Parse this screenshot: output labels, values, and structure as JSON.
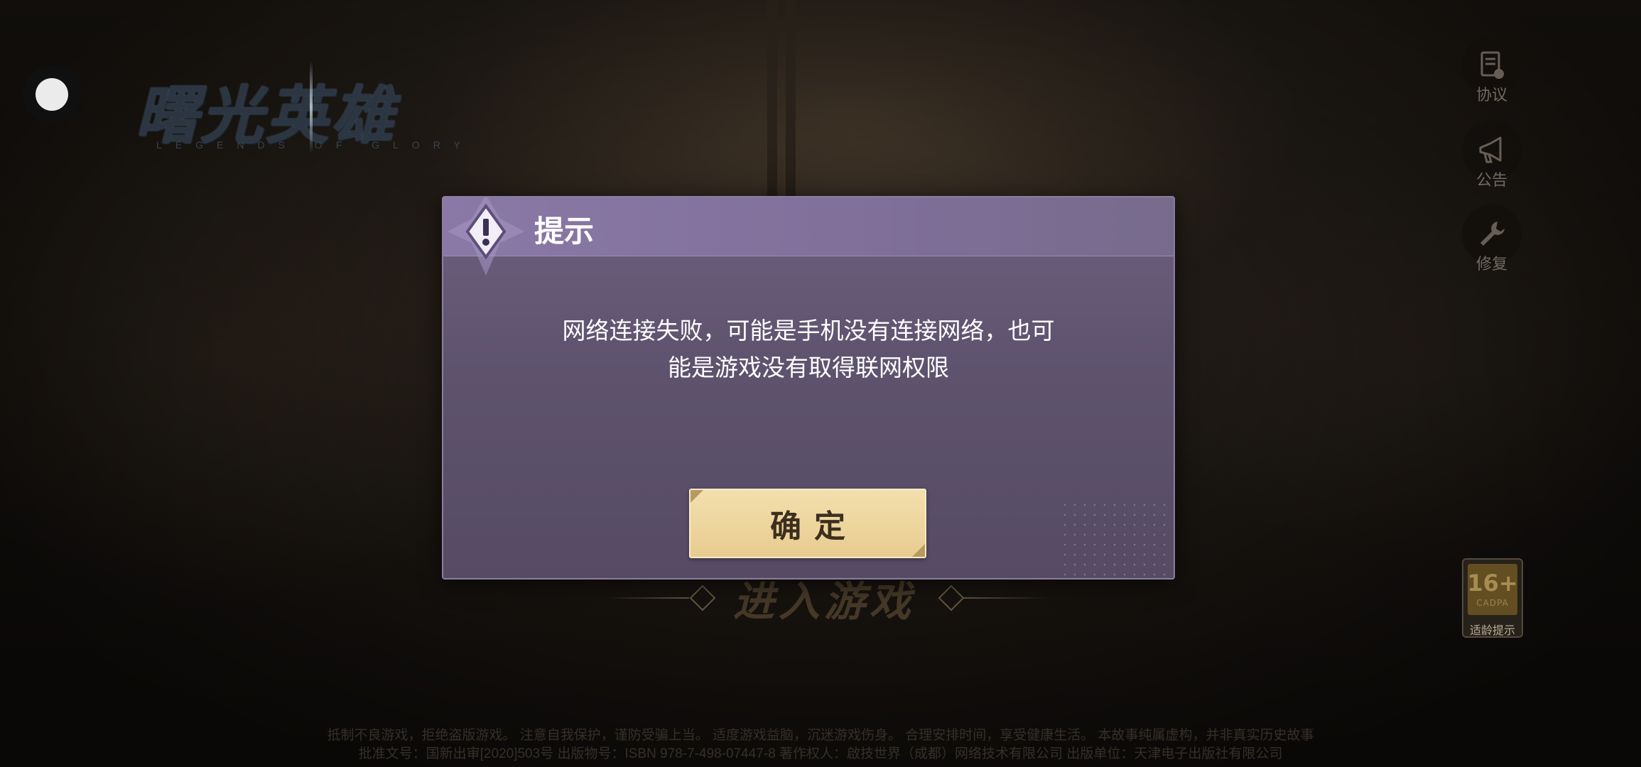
{
  "game": {
    "title": "曙光英雄",
    "subtitle": "LEGENDS OF GLORY"
  },
  "side_menu": [
    {
      "label": "协议",
      "icon": "agreement-icon"
    },
    {
      "label": "公告",
      "icon": "megaphone-icon"
    },
    {
      "label": "修复",
      "icon": "wrench-icon"
    }
  ],
  "age_rating": {
    "value": "16+",
    "org": "CADPA",
    "hint": "适龄提示"
  },
  "enter_game_label": "进入游戏",
  "footer": {
    "line1": "抵制不良游戏，拒绝盗版游戏。 注意自我保护，谨防受骗上当。 适度游戏益脑，沉迷游戏伤身。 合理安排时间，享受健康生活。 本故事纯属虚构，并非真实历史故事",
    "line2": "批准文号：国新出审[2020]503号 出版物号：ISBN 978-7-498-07447-8 著作权人：啟技世界（成都）网络技术有限公司 出版单位：天津电子出版社有限公司"
  },
  "dialog": {
    "title": "提示",
    "message_line1": "网络连接失败，可能是手机没有连接网络，也可",
    "message_line2": "能是游戏没有取得联网权限",
    "confirm_label": "确定"
  },
  "colors": {
    "dialog_bg": "#5e536e",
    "dialog_header": "#8a79a6",
    "button_gold": "#e7cc8f"
  }
}
